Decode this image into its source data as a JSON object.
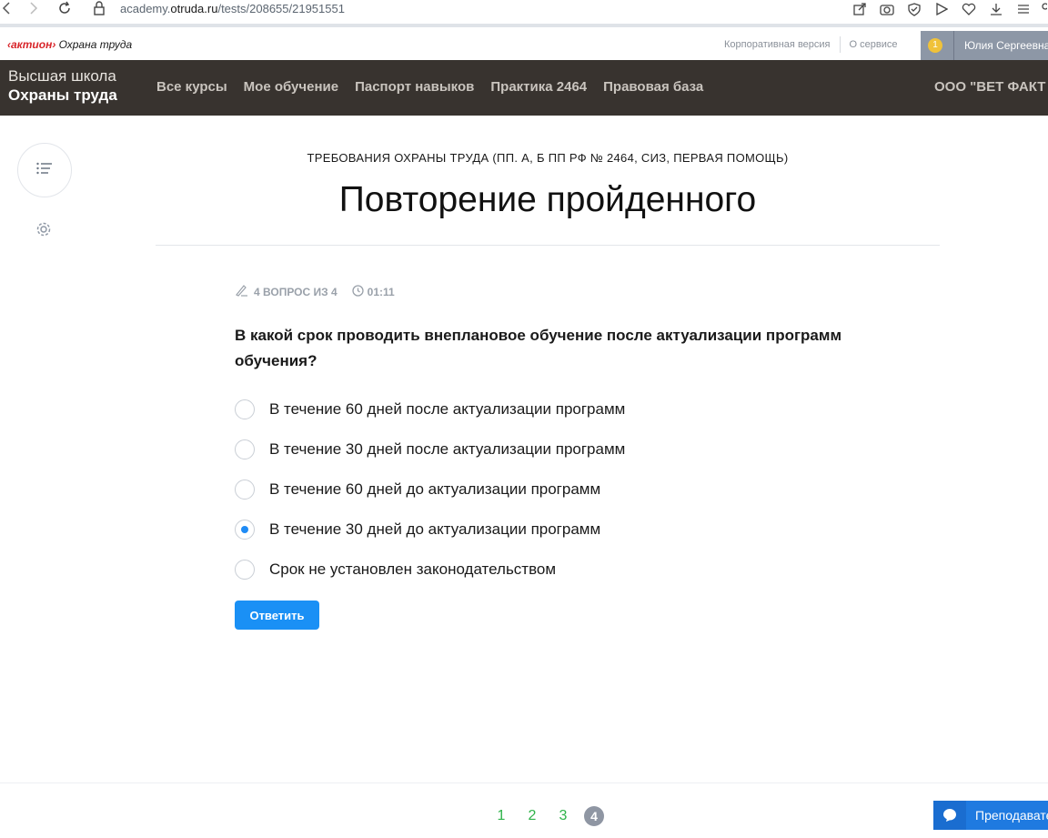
{
  "browser": {
    "url_prefix": "academy.",
    "url_host": "otruda.ru",
    "url_path": "/tests/208655/21951551"
  },
  "brand": {
    "aktion": "‹актион›",
    "product": "Охрана труда"
  },
  "toplinks": {
    "corporate": "Корпоративная версия",
    "about": "О сервисе"
  },
  "user": {
    "badge": "1",
    "name": "Юлия Сергеевна"
  },
  "school": {
    "line1": "Высшая школа",
    "line2": "Охраны труда"
  },
  "nav": {
    "items": [
      "Все курсы",
      "Мое обучение",
      "Паспорт навыков",
      "Практика 2464",
      "Правовая база"
    ],
    "org": "ООО \"ВЕТ ФАКТ"
  },
  "course": {
    "name": "ТРЕБОВАНИЯ ОХРАНЫ ТРУДА (ПП. А, Б ПП РФ № 2464, СИЗ, ПЕРВАЯ ПОМОЩЬ)",
    "title": "Повторение пройденного"
  },
  "meta": {
    "progress": "4 ВОПРОС ИЗ 4",
    "timer": "01:11"
  },
  "question": {
    "text": "В какой срок проводить внеплановое обучение после актуализации программ обучения?",
    "options": [
      {
        "label": "В течение 60 дней после актуализации программ",
        "selected": false
      },
      {
        "label": "В течение 30 дней после актуализации программ",
        "selected": false
      },
      {
        "label": "В течение 60 дней до актуализации программ",
        "selected": false
      },
      {
        "label": "В течение 30 дней до актуализации программ",
        "selected": true
      },
      {
        "label": "Срок не установлен законодательством",
        "selected": false
      }
    ],
    "answer_label": "Ответить"
  },
  "pager": {
    "pages": [
      "1",
      "2",
      "3",
      "4"
    ],
    "current": "4"
  },
  "teacher": {
    "label": "Преподавате"
  },
  "colors": {
    "nav_bg": "#38332f",
    "accent": "#1a90f5",
    "brand_red": "#d8262b",
    "page_done": "#2fb34a"
  }
}
